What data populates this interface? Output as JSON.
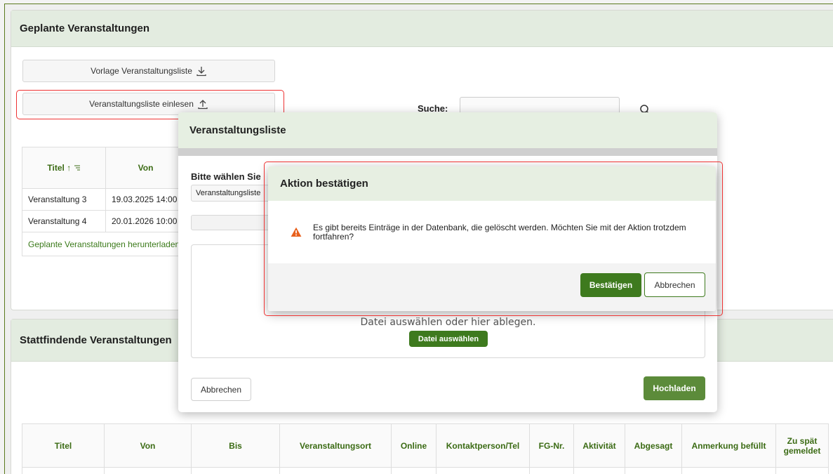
{
  "geplant": {
    "title": "Geplante Veranstaltungen",
    "template_button": "Vorlage Veranstaltungsliste",
    "import_button": "Veranstaltungsliste einlesen",
    "search_label": "Suche:",
    "search_value": "",
    "columns": [
      "Titel ↑",
      "Von"
    ],
    "rows": [
      [
        "Veranstaltung 3",
        "19.03.2025 14:00"
      ],
      [
        "Veranstaltung 4",
        "20.01.2026 10:00"
      ]
    ],
    "download_link": "Geplante Veranstaltungen herunterladen"
  },
  "stattfindend": {
    "title": "Stattfindende Veranstaltungen",
    "columns": [
      "Titel",
      "Von",
      "Bis",
      "Veranstaltungsort",
      "Online",
      "Kontaktperson/Tel",
      "FG-Nr.",
      "Aktivität",
      "Abgesagt",
      "Anmerkung befüllt",
      "Zu spät gemeldet"
    ]
  },
  "upload_modal": {
    "title": "Veranstaltungsliste",
    "prompt": "Bitte wählen Sie",
    "file_type_value": "Veranstaltungsliste",
    "dropzone_text": "Datei auswählen oder hier ablegen.",
    "choose_file_button": "Datei auswählen",
    "cancel_button": "Abbrechen",
    "upload_button": "Hochladen"
  },
  "confirm_dialog": {
    "title": "Aktion bestätigen",
    "message": "Es gibt bereits Einträge in der Datenbank, die gelöscht werden. Möchten Sie mit der Aktion trotzdem fortfahren?",
    "confirm_button": "Bestätigen",
    "cancel_button": "Abbrechen"
  },
  "colors": {
    "accent_green": "#3e7a1e",
    "header_bg": "#e3ece0",
    "highlight_red": "#e33333",
    "warning_orange": "#e8601c"
  }
}
